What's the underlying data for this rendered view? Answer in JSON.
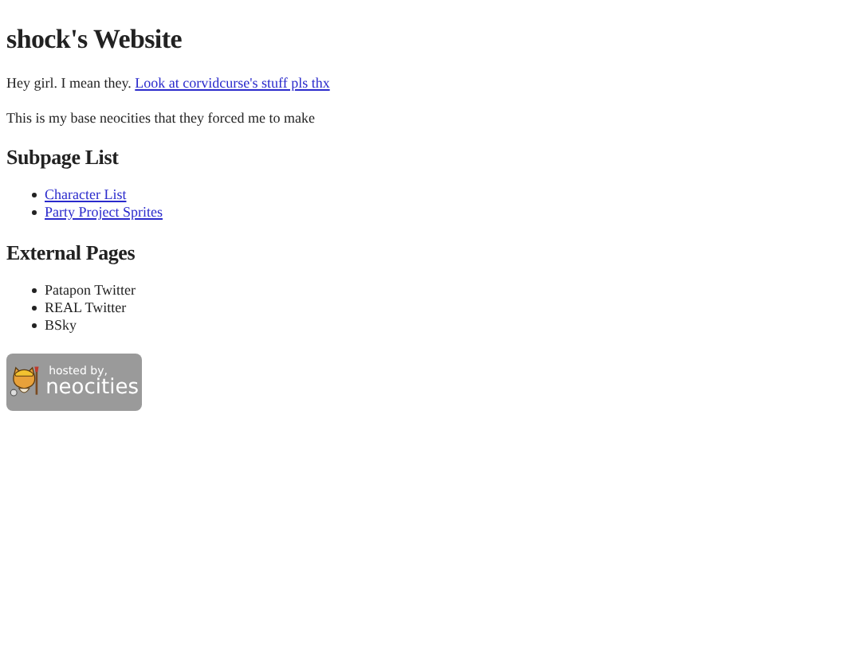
{
  "title": "shock's Website",
  "paragraphs": [
    {
      "parts": [
        {
          "text": "Hey girl. I mean they. ",
          "kind": "text"
        },
        {
          "text": "Look at corvidcurse's stuff pls thx",
          "kind": "link"
        }
      ]
    },
    {
      "parts": [
        {
          "text": "This is my base neocities that they forced me to make",
          "kind": "text"
        }
      ]
    }
  ],
  "sections": [
    {
      "heading": "Subpage List",
      "items": [
        {
          "text": "Character List",
          "kind": "link"
        },
        {
          "text": "Party Project Sprites",
          "kind": "link"
        }
      ]
    },
    {
      "heading": "External Pages",
      "items": [
        {
          "text": "Patapon Twitter",
          "kind": "text"
        },
        {
          "text": "REAL Twitter",
          "kind": "text"
        },
        {
          "text": "BSky",
          "kind": "text"
        }
      ]
    }
  ],
  "badge": {
    "line_1": "hosted by,",
    "line_2": "neocities"
  }
}
